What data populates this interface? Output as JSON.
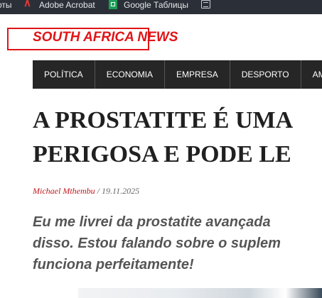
{
  "bookmarks": [
    {
      "label": "оты",
      "icon": "none"
    },
    {
      "label": "Adobe Acrobat",
      "icon": "acrobat-icon"
    },
    {
      "label": "Google Таблицы",
      "icon": "sheets-icon"
    },
    {
      "label": "",
      "icon": "folder-icon"
    }
  ],
  "site": {
    "name": "SOUTH AFRICA NEWS",
    "accent_color": "#e01418"
  },
  "nav": {
    "items": [
      "POLÍTICA",
      "ECONOMIA",
      "EMPRESA",
      "DESPORTO",
      "AM"
    ]
  },
  "article": {
    "headline_lines": [
      "A PROSTATITE É UMA",
      "PERIGOSA E PODE LE"
    ],
    "author": "Michael Mthembu",
    "separator": " / ",
    "date": "19.11.2025",
    "lead_lines": [
      "Eu me livrei da prostatite avançada",
      "disso. Estou falando sobre o suplem",
      "funciona perfeitamente!"
    ]
  }
}
